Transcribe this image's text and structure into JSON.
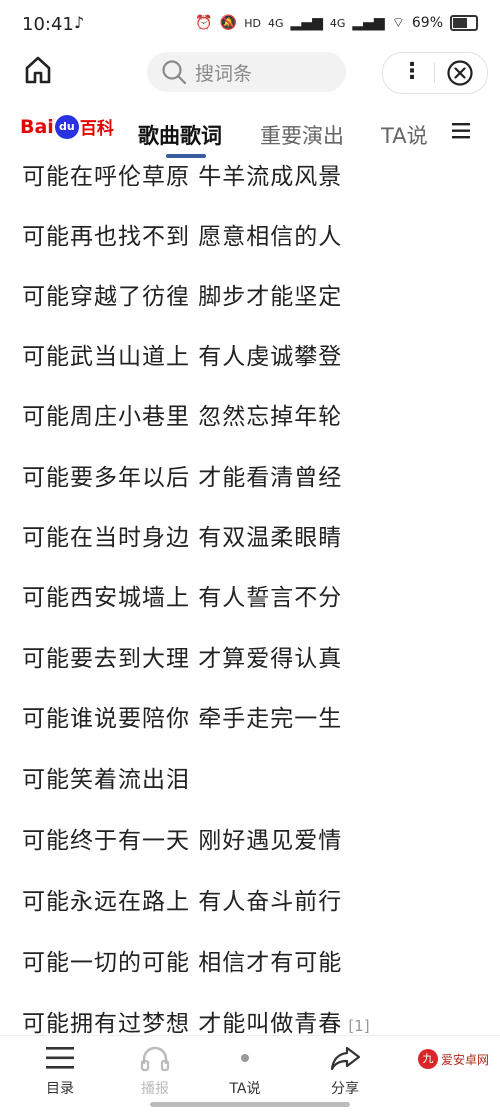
{
  "status_bar": {
    "time": "10:41",
    "signal_1": "4G",
    "hd_label": "HD",
    "signal_2": "4G",
    "battery": "69%"
  },
  "top_bar": {
    "search_placeholder": "搜词条"
  },
  "logo": {
    "bai": "Bai",
    "du": "du",
    "baike": "百科"
  },
  "tabs": [
    {
      "label": "歌曲歌词",
      "active": true
    },
    {
      "label": "重要演出",
      "active": false
    },
    {
      "label": "TA说",
      "active": false
    }
  ],
  "lyrics": [
    "可能在呼伦草原 牛羊流成风景",
    "可能再也找不到 愿意相信的人",
    "可能穿越了彷徨 脚步才能坚定",
    "可能武当山道上 有人虔诚攀登",
    "可能周庄小巷里 忽然忘掉年轮",
    "可能要多年以后 才能看清曾经",
    "可能在当时身边 有双温柔眼睛",
    "可能西安城墙上 有人誓言不分",
    "可能要去到大理 才算爱得认真",
    "可能谁说要陪你 牵手走完一生",
    "可能笑着流出泪",
    "可能终于有一天 刚好遇见爱情",
    "可能永远在路上 有人奋斗前行",
    "可能一切的可能 相信才有可能",
    "可能拥有过梦想 才能叫做青春"
  ],
  "reference_mark": "[1]",
  "bottom_bar": {
    "catalog": "目录",
    "broadcast": "播报",
    "ta_says": "TA说",
    "share": "分享"
  },
  "watermark": {
    "logo": "九",
    "text": "爱安卓网"
  }
}
